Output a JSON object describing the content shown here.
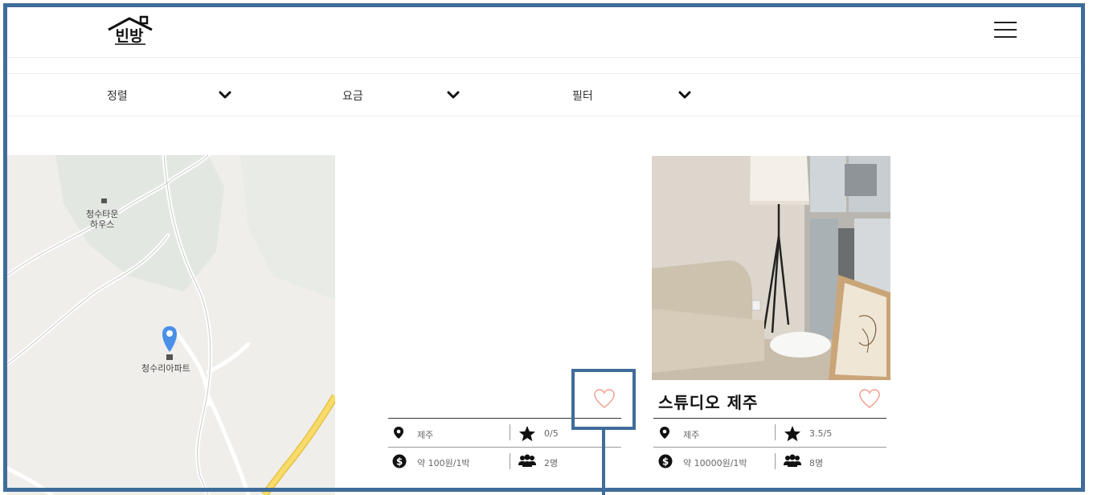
{
  "header": {
    "logo_text": "빈방",
    "menu_icon": "hamburger-menu-icon"
  },
  "filters": [
    {
      "label": "정렬"
    },
    {
      "label": "요금"
    },
    {
      "label": "필터"
    }
  ],
  "map": {
    "labels": {
      "townhouse_line1": "청수타운",
      "townhouse_line2": "하우스",
      "apartment": "청수리아파트"
    },
    "marker_icon": "map-pin-icon"
  },
  "listings": [
    {
      "title": "",
      "location": "제주",
      "rating": "0/5",
      "price": "약 100원/1박",
      "guests": "2명"
    },
    {
      "title": "스튜디오 제주",
      "location": "제주",
      "rating": "3.5/5",
      "price": "약 10000원/1박",
      "guests": "8명"
    }
  ],
  "colors": {
    "annotation": "#3f6c9a",
    "heart": "#f0a090",
    "map_pin": "#4a8fe8",
    "road_yellow": "#f5d046"
  }
}
